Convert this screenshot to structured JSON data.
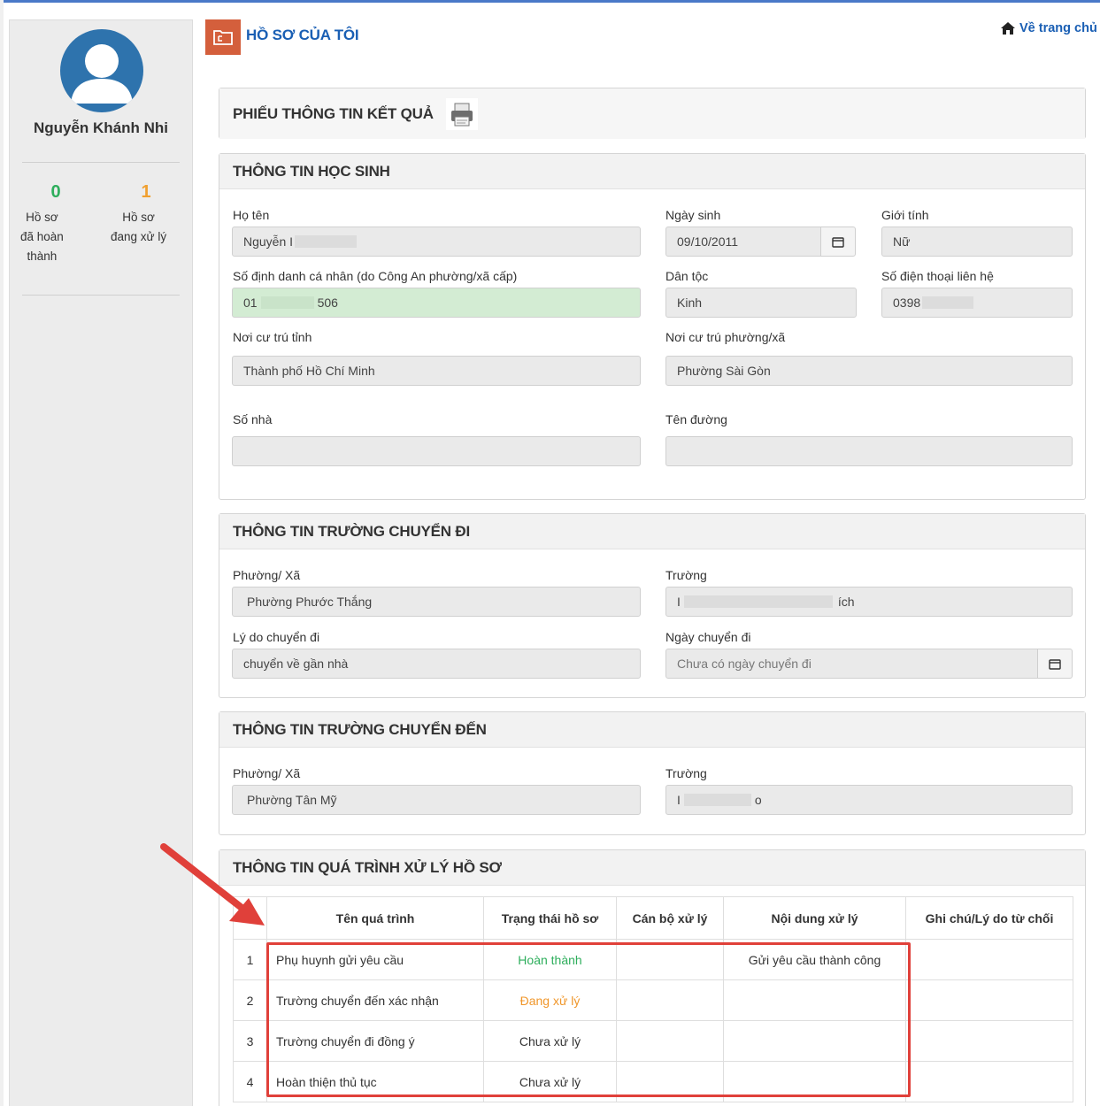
{
  "sidebar": {
    "user_name": "Nguyễn Khánh Nhi",
    "stats": [
      {
        "value": "0",
        "label_lines": [
          "Hồ sơ",
          "đã hoàn",
          "thành"
        ],
        "color": "#2eae5c"
      },
      {
        "value": "1",
        "label_lines": [
          "Hồ sơ",
          "đang xử lý"
        ],
        "color": "#f0a030"
      }
    ]
  },
  "header": {
    "title": "HỒ SƠ CỦA TÔI",
    "home_link": "Về trang chủ"
  },
  "result_panel": {
    "title": "PHIẾU THÔNG TIN KẾT QUẢ"
  },
  "student": {
    "title": "THÔNG TIN HỌC SINH",
    "fields": {
      "ho_ten": {
        "label": "Họ tên",
        "value": "Nguyễn I"
      },
      "ngay_sinh": {
        "label": "Ngày sinh",
        "value": "09/10/2011"
      },
      "gioi_tinh": {
        "label": "Giới tính",
        "value": "Nữ"
      },
      "so_dinh_danh": {
        "label": "Số định danh cá nhân (do Công An phường/xã cấp)",
        "value_start": "01",
        "value_end": "506"
      },
      "dan_toc": {
        "label": "Dân tộc",
        "value": "Kinh"
      },
      "so_dien_thoai": {
        "label": "Số điện thoại liên hệ",
        "value": "0398"
      },
      "tinh": {
        "label": "Nơi cư trú tỉnh",
        "value": "Thành phố Hồ Chí Minh"
      },
      "phuong": {
        "label": "Nơi cư trú phường/xã",
        "value": "Phường Sài Gòn"
      },
      "so_nha": {
        "label": "Số nhà",
        "value": ""
      },
      "ten_duong": {
        "label": "Tên đường",
        "value": ""
      }
    }
  },
  "transfer_from": {
    "title": "THÔNG TIN TRƯỜNG CHUYỂN ĐI",
    "fields": {
      "phuong": {
        "label": "Phường/ Xã",
        "value": "Phường Phước Thắng"
      },
      "truong": {
        "label": "Trường",
        "value_start": "I",
        "value_end": "ích"
      },
      "ly_do": {
        "label": "Lý do chuyển đi",
        "value": "chuyển về gần nhà"
      },
      "ngay_chuyen": {
        "label": "Ngày chuyển đi",
        "placeholder": "Chưa có ngày chuyển đi"
      }
    }
  },
  "transfer_to": {
    "title": "THÔNG TIN TRƯỜNG CHUYỂN ĐẾN",
    "fields": {
      "phuong": {
        "label": "Phường/ Xã",
        "value": "Phường Tân Mỹ"
      },
      "truong": {
        "label": "Trường",
        "value_start": "I",
        "value_end": "o"
      }
    }
  },
  "process": {
    "title": "THÔNG TIN QUÁ TRÌNH XỬ LÝ HỒ SƠ",
    "columns": [
      "",
      "Tên quá trình",
      "Trạng thái hồ sơ",
      "Cán bộ xử lý",
      "Nội dung xử lý",
      "Ghi chú/Lý do từ chối"
    ],
    "rows": [
      {
        "index": "1",
        "name": "Phụ huynh gửi yêu cầu",
        "status": "Hoàn thành",
        "status_color": "#2eae5c",
        "officer": "",
        "content": "Gửi yêu cầu thành công",
        "note": ""
      },
      {
        "index": "2",
        "name": "Trường chuyển đến xác nhận",
        "status": "Đang xử lý",
        "status_color": "#f0962a",
        "officer": "",
        "content": "",
        "note": ""
      },
      {
        "index": "3",
        "name": "Trường chuyển đi đồng ý",
        "status": "Chưa xử lý",
        "status_color": "#333333",
        "officer": "",
        "content": "",
        "note": ""
      },
      {
        "index": "4",
        "name": "Hoàn thiện thủ tục",
        "status": "Chưa xử lý",
        "status_color": "#333333",
        "officer": "",
        "content": "",
        "note": ""
      }
    ]
  },
  "colors": {
    "accent": "#1a5fb4",
    "header_icon_bg": "#d45f3c",
    "highlight": "#e0403a",
    "success": "#2eae5c",
    "warning": "#f0962a"
  }
}
